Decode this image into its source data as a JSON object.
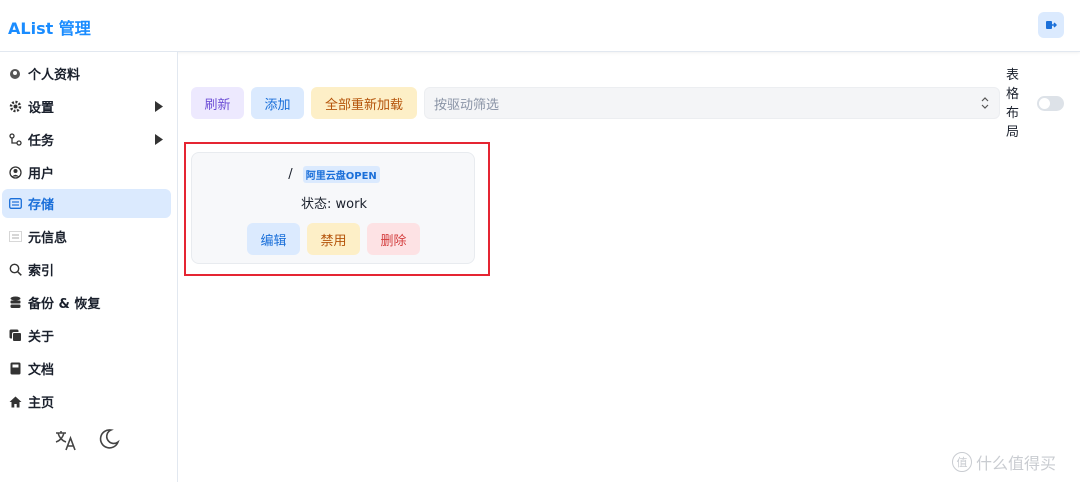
{
  "header": {
    "brand": "AList 管理",
    "logout_icon": "logout-icon"
  },
  "sidebar": {
    "items": [
      {
        "label": "个人资料",
        "icon": "profile-icon"
      },
      {
        "label": "设置",
        "icon": "gear-icon",
        "has_arrow": true
      },
      {
        "label": "任务",
        "icon": "tasks-icon",
        "has_arrow": true
      },
      {
        "label": "用户",
        "icon": "user-icon"
      },
      {
        "label": "存储",
        "icon": "storage-icon",
        "active": true
      },
      {
        "label": "元信息",
        "icon": "meta-icon"
      },
      {
        "label": "索引",
        "icon": "search-icon"
      },
      {
        "label": "备份 & 恢复",
        "icon": "database-icon"
      },
      {
        "label": "关于",
        "icon": "about-icon"
      },
      {
        "label": "文档",
        "icon": "book-icon"
      },
      {
        "label": "主页",
        "icon": "home-icon"
      }
    ],
    "tools": [
      "translate-icon",
      "moon-icon"
    ]
  },
  "toolbar": {
    "refresh_label": "刷新",
    "add_label": "添加",
    "reload_all_label": "全部重新加载",
    "filter_placeholder": "按驱动筛选"
  },
  "layout_toggle": {
    "label": "表格布局",
    "chars": [
      "表",
      "格",
      "布",
      "局"
    ],
    "enabled": false
  },
  "storage_card": {
    "path": "/",
    "driver_tag": "阿里云盘OPEN",
    "status": "状态: work",
    "edit_label": "编辑",
    "disable_label": "禁用",
    "delete_label": "删除"
  },
  "watermark": {
    "text": "什么值得买",
    "glyph": "值"
  },
  "colors": {
    "accent": "#1a8cff",
    "highlight": "#e52532"
  }
}
